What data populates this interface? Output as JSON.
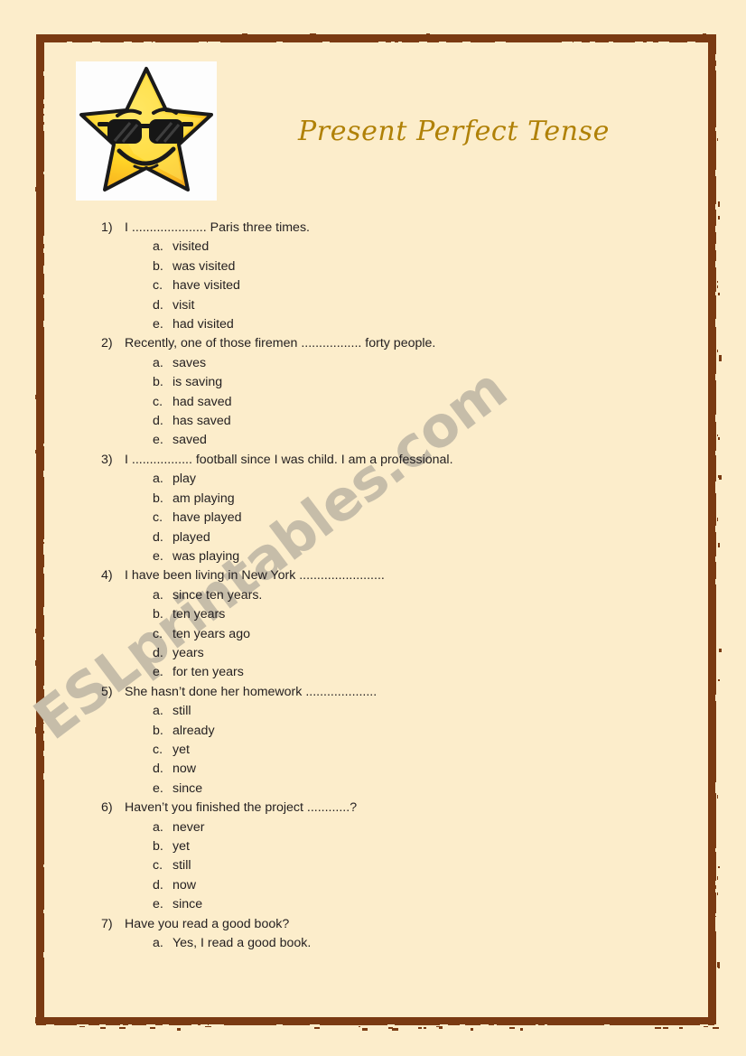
{
  "page": {
    "background_color": "#fcedcb",
    "frame_color": "#7a3a12"
  },
  "header": {
    "title": "Present Perfect Tense",
    "title_color": "#b08107",
    "star_icon_label": "smiling star wearing sunglasses"
  },
  "watermark": {
    "text": "ESLprintables.com",
    "color": "#c6bda9"
  },
  "quiz": {
    "questions": [
      {
        "number": "1)",
        "text": "I ..................... Paris three times.",
        "options": [
          {
            "letter": "a.",
            "text": "visited"
          },
          {
            "letter": "b.",
            "text": "was visited"
          },
          {
            "letter": "c.",
            "text": "have visited"
          },
          {
            "letter": "d.",
            "text": "visit"
          },
          {
            "letter": "e.",
            "text": "had visited"
          }
        ]
      },
      {
        "number": "2)",
        "text": "Recently, one of those firemen ................. forty people.",
        "options": [
          {
            "letter": "a.",
            "text": "saves"
          },
          {
            "letter": "b.",
            "text": "is saving"
          },
          {
            "letter": "c.",
            "text": "had saved"
          },
          {
            "letter": "d.",
            "text": "has saved"
          },
          {
            "letter": "e.",
            "text": "saved"
          }
        ]
      },
      {
        "number": "3)",
        "text": "I ................. football since I was child. I am a professional.",
        "options": [
          {
            "letter": "a.",
            "text": "play"
          },
          {
            "letter": "b.",
            "text": "am playing"
          },
          {
            "letter": "c.",
            "text": " have played"
          },
          {
            "letter": "d.",
            "text": "played"
          },
          {
            "letter": "e.",
            "text": "was playing"
          }
        ]
      },
      {
        "number": "4)",
        "text": "I have been living in New York ........................",
        "options": [
          {
            "letter": "a.",
            "text": "since ten years."
          },
          {
            "letter": "b.",
            "text": "ten years"
          },
          {
            "letter": "c.",
            "text": "ten years ago"
          },
          {
            "letter": "d.",
            "text": "years"
          },
          {
            "letter": "e.",
            "text": "for ten years"
          }
        ]
      },
      {
        "number": "5)",
        "text": "She hasn’t done her homework ....................",
        "options": [
          {
            "letter": "a.",
            "text": "still"
          },
          {
            "letter": "b.",
            "text": "already"
          },
          {
            "letter": "c.",
            "text": "yet"
          },
          {
            "letter": "d.",
            "text": "now"
          },
          {
            "letter": "e.",
            "text": "since"
          }
        ]
      },
      {
        "number": "6)",
        "text": "Haven’t you finished the project ............?",
        "options": [
          {
            "letter": "a.",
            "text": "never"
          },
          {
            "letter": "b.",
            "text": "yet"
          },
          {
            "letter": "c.",
            "text": "still"
          },
          {
            "letter": "d.",
            "text": "now"
          },
          {
            "letter": "e.",
            "text": "since"
          }
        ]
      },
      {
        "number": "7)",
        "text": "Have you read a good book?",
        "options": [
          {
            "letter": "a.",
            "text": "Yes, I read a good book."
          }
        ]
      }
    ]
  }
}
